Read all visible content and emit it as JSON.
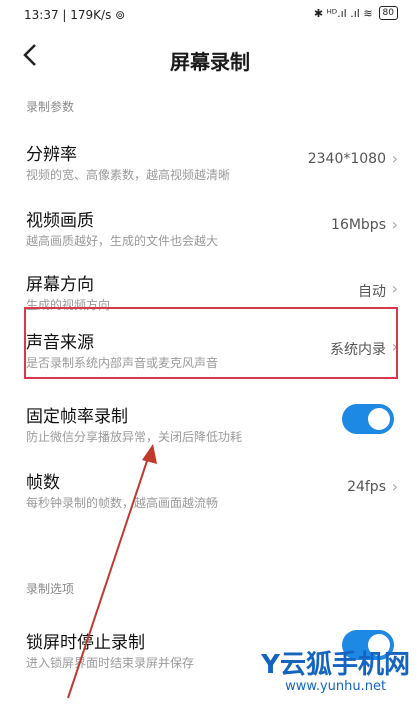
{
  "status": {
    "left": "13:37 | 179K/s ⊚",
    "right": "✱ ᴴᴰ.ıl .ıl ≋",
    "battery": "80"
  },
  "header": {
    "back_icon": "chevron-left-icon",
    "title": "屏幕录制"
  },
  "sections": {
    "params": "录制参数",
    "options": "录制选项"
  },
  "rows": [
    {
      "title": "分辨率",
      "sub": "视频的宽、高像素数，越高视频越清晰",
      "value": "2340*1080"
    },
    {
      "title": "视频画质",
      "sub": "越高画质越好，生成的文件也会越大",
      "value": "16Mbps"
    },
    {
      "title": "屏幕方向",
      "sub": "生成的视频方向",
      "value": "自动"
    },
    {
      "title": "声音来源",
      "sub": "是否录制系统内部声音或麦克风声音",
      "value": "系统内录"
    },
    {
      "title": "固定帧率录制",
      "sub": "防止微信分享播放异常，关闭后降低功耗",
      "toggle": true
    },
    {
      "title": "帧数",
      "sub": "每秒钟录制的帧数，越高画面越流畅",
      "value": "24fps"
    },
    {
      "title": "锁屏时停止录制",
      "sub": "进入锁屏界面时结束录屏并保存",
      "toggle": true
    }
  ],
  "watermark": {
    "main": "Y云狐手机网",
    "url": "www.yunhu.net"
  },
  "colors": {
    "toggle_on": "#1e88e5",
    "highlight_box": "#d63a4a",
    "arrow": "#c0392b"
  }
}
